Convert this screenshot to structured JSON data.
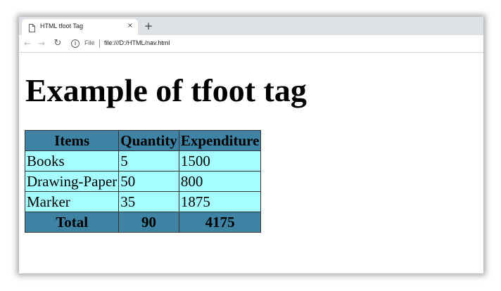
{
  "browser": {
    "tab": {
      "title": "HTML tfoot Tag",
      "close_glyph": "×"
    },
    "new_tab_glyph": "+",
    "toolbar": {
      "back_glyph": "←",
      "forward_glyph": "→",
      "reload_glyph": "↻",
      "info_glyph": "i",
      "scheme_label": "File",
      "url": "file:///D:/HTML/nav.html"
    }
  },
  "page": {
    "heading": "Example of tfoot tag",
    "table": {
      "headers": [
        "Items",
        "Quantity",
        "Expenditure"
      ],
      "rows": [
        [
          "Books",
          "5",
          "1500"
        ],
        [
          "Drawing-Paper",
          "50",
          "800"
        ],
        [
          "Marker",
          "35",
          "1875"
        ]
      ],
      "footer": [
        "Total",
        "90",
        "4175"
      ]
    }
  },
  "colors": {
    "header_bg": "#3e83a3",
    "body_bg": "#a6fdff",
    "tabstrip_bg": "#dee1e6"
  }
}
